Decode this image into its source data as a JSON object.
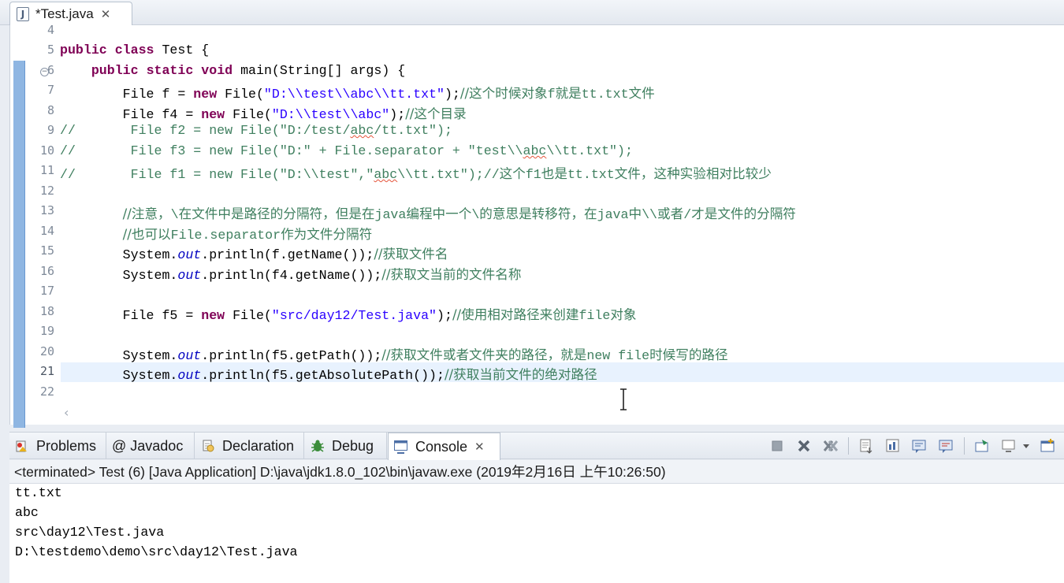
{
  "editor": {
    "tab": {
      "label": "*Test.java",
      "icon": "java-file-icon"
    },
    "line_numbers": [
      "4",
      "5",
      "6",
      "7",
      "8",
      "9",
      "10",
      "11",
      "12",
      "13",
      "14",
      "15",
      "16",
      "17",
      "18",
      "19",
      "20",
      "21",
      "22"
    ],
    "current_line": "21",
    "code": {
      "l5": {
        "kw1": "public",
        "kw2": "class",
        "rest": " Test {"
      },
      "l6": {
        "kw1": "public",
        "kw2": "static",
        "kw3": "void",
        "rest": " main(String[] args) {"
      },
      "l7": {
        "a": "File f = ",
        "kw": "new",
        "b": " File(",
        "s": "\"D:\\\\test\\\\abc\\\\tt.txt\"",
        "c": ");",
        "m1": "//这个时候对象",
        "m2": "f",
        "m3": "就是",
        "m4": "tt.txt",
        "m5": "文件"
      },
      "l8": {
        "a": "File f4 = ",
        "kw": "new",
        "b": " File(",
        "s": "\"D:\\\\test\\\\abc\"",
        "c": ");",
        "m1": "//这个目录"
      },
      "l9": {
        "a": "//       File f2 = new File(\"D:/test/",
        "sq": "abc",
        "b": "/tt.txt\");"
      },
      "l10": {
        "a": "//       File f3 = new File(\"D:\" + File.separator + \"test\\\\",
        "sq": "abc",
        "b": "\\\\tt.txt\");"
      },
      "l11": {
        "a": "//       File f1 = new File(\"D:\\\\test\",\"",
        "sq": "abc",
        "b": "\\\\tt.txt\");//",
        "m1": "这个",
        "m2": "f1",
        "m3": "也是",
        "m4": "tt.txt",
        "m5": "文件，这种实验相对比较少"
      },
      "l13": {
        "p1": "//注意，",
        "p2": "\\",
        "p3": "在文件中是路径的分隔符，但是在",
        "p4": "java",
        "p5": "编程中一个",
        "p6": "\\",
        "p7": "的意思是转移符，在",
        "p8": "java",
        "p9": "中",
        "p10": "\\\\",
        "p11": "或者",
        "p12": "/",
        "p13": "才是文件的分隔符"
      },
      "l14": {
        "p1": "//也可以",
        "p2": "File.separator",
        "p3": "作为文件分隔符"
      },
      "l15": {
        "a": "System.",
        "f": "out",
        "b": ".println(f.getName());",
        "m1": "//获取文件名"
      },
      "l16": {
        "a": "System.",
        "f": "out",
        "b": ".println(f4.getName());",
        "m1": "//获取文当前的文件名称"
      },
      "l18": {
        "a": "File f5 = ",
        "kw": "new",
        "b": " File(",
        "s": "\"src/day12/Test.java\"",
        "c": ");",
        "m1": "//使用相对路径来创建",
        "m2": "file",
        "m3": "对象"
      },
      "l20": {
        "a": "System.",
        "f": "out",
        "b": ".println(f5.getPath());",
        "m1": "//获取文件或者文件夹的路径，就是",
        "m2": "new file",
        "m3": "时候写的路径"
      },
      "l21": {
        "a": "System.",
        "f": "out",
        "b": ".println(f5.getAbsolutePath());",
        "m1": "//获取当前文件的绝对路径"
      }
    }
  },
  "views": {
    "tabs": [
      {
        "label": "Problems",
        "icon": "problems-icon"
      },
      {
        "label": "@ Javadoc",
        "icon": "javadoc-icon"
      },
      {
        "label": "Declaration",
        "icon": "declaration-icon"
      },
      {
        "label": "Debug",
        "icon": "debug-icon"
      },
      {
        "label": "Console",
        "icon": "console-icon",
        "active": true
      }
    ],
    "toolbar": [
      "terminate-icon",
      "remove-launch-icon",
      "remove-all-terminated-icon",
      "scroll-lock-icon",
      "word-wrap-icon",
      "show-on-stdout-icon",
      "show-on-stderr-icon",
      "pin-console-icon",
      "display-console-icon",
      "dropdown-arrow-icon",
      "open-console-icon"
    ]
  },
  "console": {
    "status": "<terminated> Test (6) [Java Application] D:\\java\\jdk1.8.0_102\\bin\\javaw.exe (2019年2月16日 上午10:26:50)",
    "output": [
      "tt.txt",
      "abc",
      "src\\day12\\Test.java",
      "D:\\testdemo\\demo\\src\\day12\\Test.java"
    ]
  },
  "colors": {
    "keyword": "#7f0055",
    "string": "#2a00ff",
    "comment": "#3f7f5f",
    "field": "#0000c0",
    "ruler": "#8fb6e2",
    "current_line": "#e8f2fe"
  }
}
